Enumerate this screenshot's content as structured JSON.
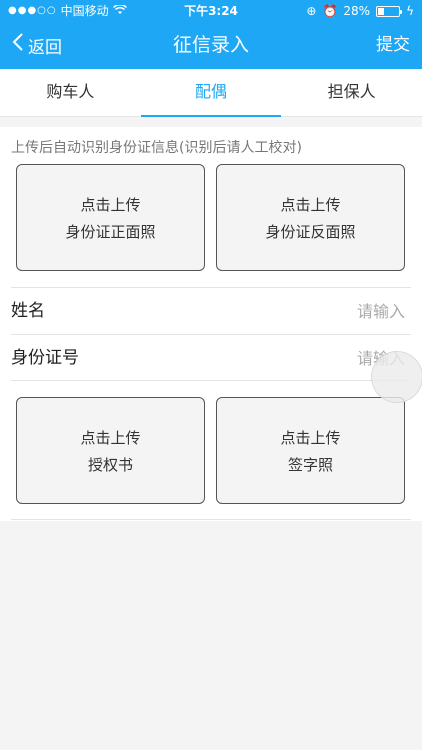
{
  "status": {
    "carrier": "中国移动",
    "time": "下午3:24",
    "battery_percent_label": "28%",
    "battery_level": 0.28
  },
  "nav": {
    "back_label": "返回",
    "title": "征信录入",
    "submit_label": "提交"
  },
  "tabs": [
    {
      "label": "购车人"
    },
    {
      "label": "配偶"
    },
    {
      "label": "担保人"
    }
  ],
  "content": {
    "hint": "上传后自动识别身份证信息(识别后请人工校对)",
    "upload_front": {
      "line1": "点击上传",
      "line2": "身份证正面照"
    },
    "upload_back": {
      "line1": "点击上传",
      "line2": "身份证反面照"
    },
    "name": {
      "label": "姓名",
      "placeholder": "请输入",
      "value": ""
    },
    "id_number": {
      "label": "身份证号",
      "placeholder": "请输入",
      "value": ""
    },
    "upload_auth": {
      "line1": "点击上传",
      "line2": "授权书"
    },
    "upload_signature": {
      "line1": "点击上传",
      "line2": "签字照"
    }
  },
  "colors": {
    "accent": "#1ea7f5",
    "background": "#f4f4f4"
  }
}
